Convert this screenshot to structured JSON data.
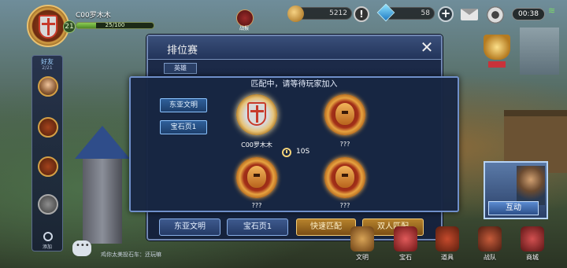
{
  "topbar": {
    "player_name": "C00罗木木",
    "level": "21",
    "exp_text": "25/100",
    "exp_fraction": 0.25,
    "report_label": "战报",
    "coins": "5212",
    "gems": "58",
    "clock": "00:38"
  },
  "sidebar": {
    "friends_label": "好友",
    "friends_count": "2/21",
    "search_label": "添加"
  },
  "rank_window": {
    "title": "排位赛",
    "tab_label": "英雄",
    "buttons": [
      "东亚文明",
      "宝石页1",
      "快速匹配",
      "双人匹配"
    ]
  },
  "match_popup": {
    "header": "匹配中，请等待玩家加入",
    "civ_buttons": [
      "东亚文明",
      "宝石页1"
    ],
    "slots": [
      {
        "name": "C00罗木木",
        "filled": true
      },
      {
        "name": "???",
        "filled": false
      },
      {
        "name": "???",
        "filled": false
      },
      {
        "name": "???",
        "filled": false
      }
    ],
    "timer": "10S"
  },
  "right_panel": {
    "interact_label": "互动"
  },
  "bottombar": {
    "chat_text": "鸡你太美投石车：还玩嘛",
    "dock": [
      "文明",
      "宝石",
      "道具",
      "战队",
      "商城"
    ]
  },
  "colors": {
    "popup_bg": "#182642",
    "accent_blue": "#6f8fca",
    "gold": "#e7a340"
  }
}
